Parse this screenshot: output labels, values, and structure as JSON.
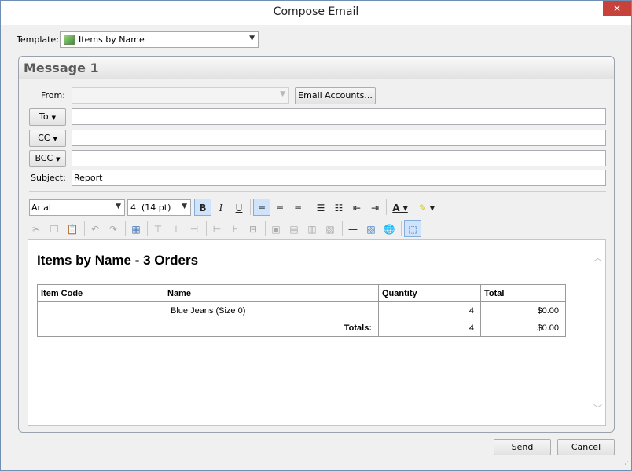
{
  "window": {
    "title": "Compose Email",
    "close_glyph": "✕"
  },
  "template": {
    "label": "Template:",
    "value": "Items by Name"
  },
  "message": {
    "title": "Message 1",
    "from_label": "From:",
    "from_value": "",
    "email_accounts_label": "Email Accounts...",
    "to_label": "To",
    "cc_label": "CC",
    "bcc_label": "BCC",
    "to_value": "",
    "cc_value": "",
    "bcc_value": "",
    "subject_label": "Subject:",
    "subject_value": "Report"
  },
  "toolbar": {
    "font_family": "Arial",
    "font_size": "4  (14 pt)"
  },
  "editor": {
    "heading": "Items by Name - 3 Orders",
    "columns": [
      "Item Code",
      "Name",
      "Quantity",
      "Total"
    ],
    "rows": [
      {
        "item_code": "",
        "name": "Blue Jeans (Size 0)",
        "quantity": "4",
        "total": "$0.00"
      }
    ],
    "totals": {
      "label": "Totals:",
      "quantity": "4",
      "total": "$0.00"
    }
  },
  "footer": {
    "send_label": "Send",
    "cancel_label": "Cancel"
  },
  "colors": {
    "accent": "#cfe3fa",
    "close": "#c7423a"
  }
}
